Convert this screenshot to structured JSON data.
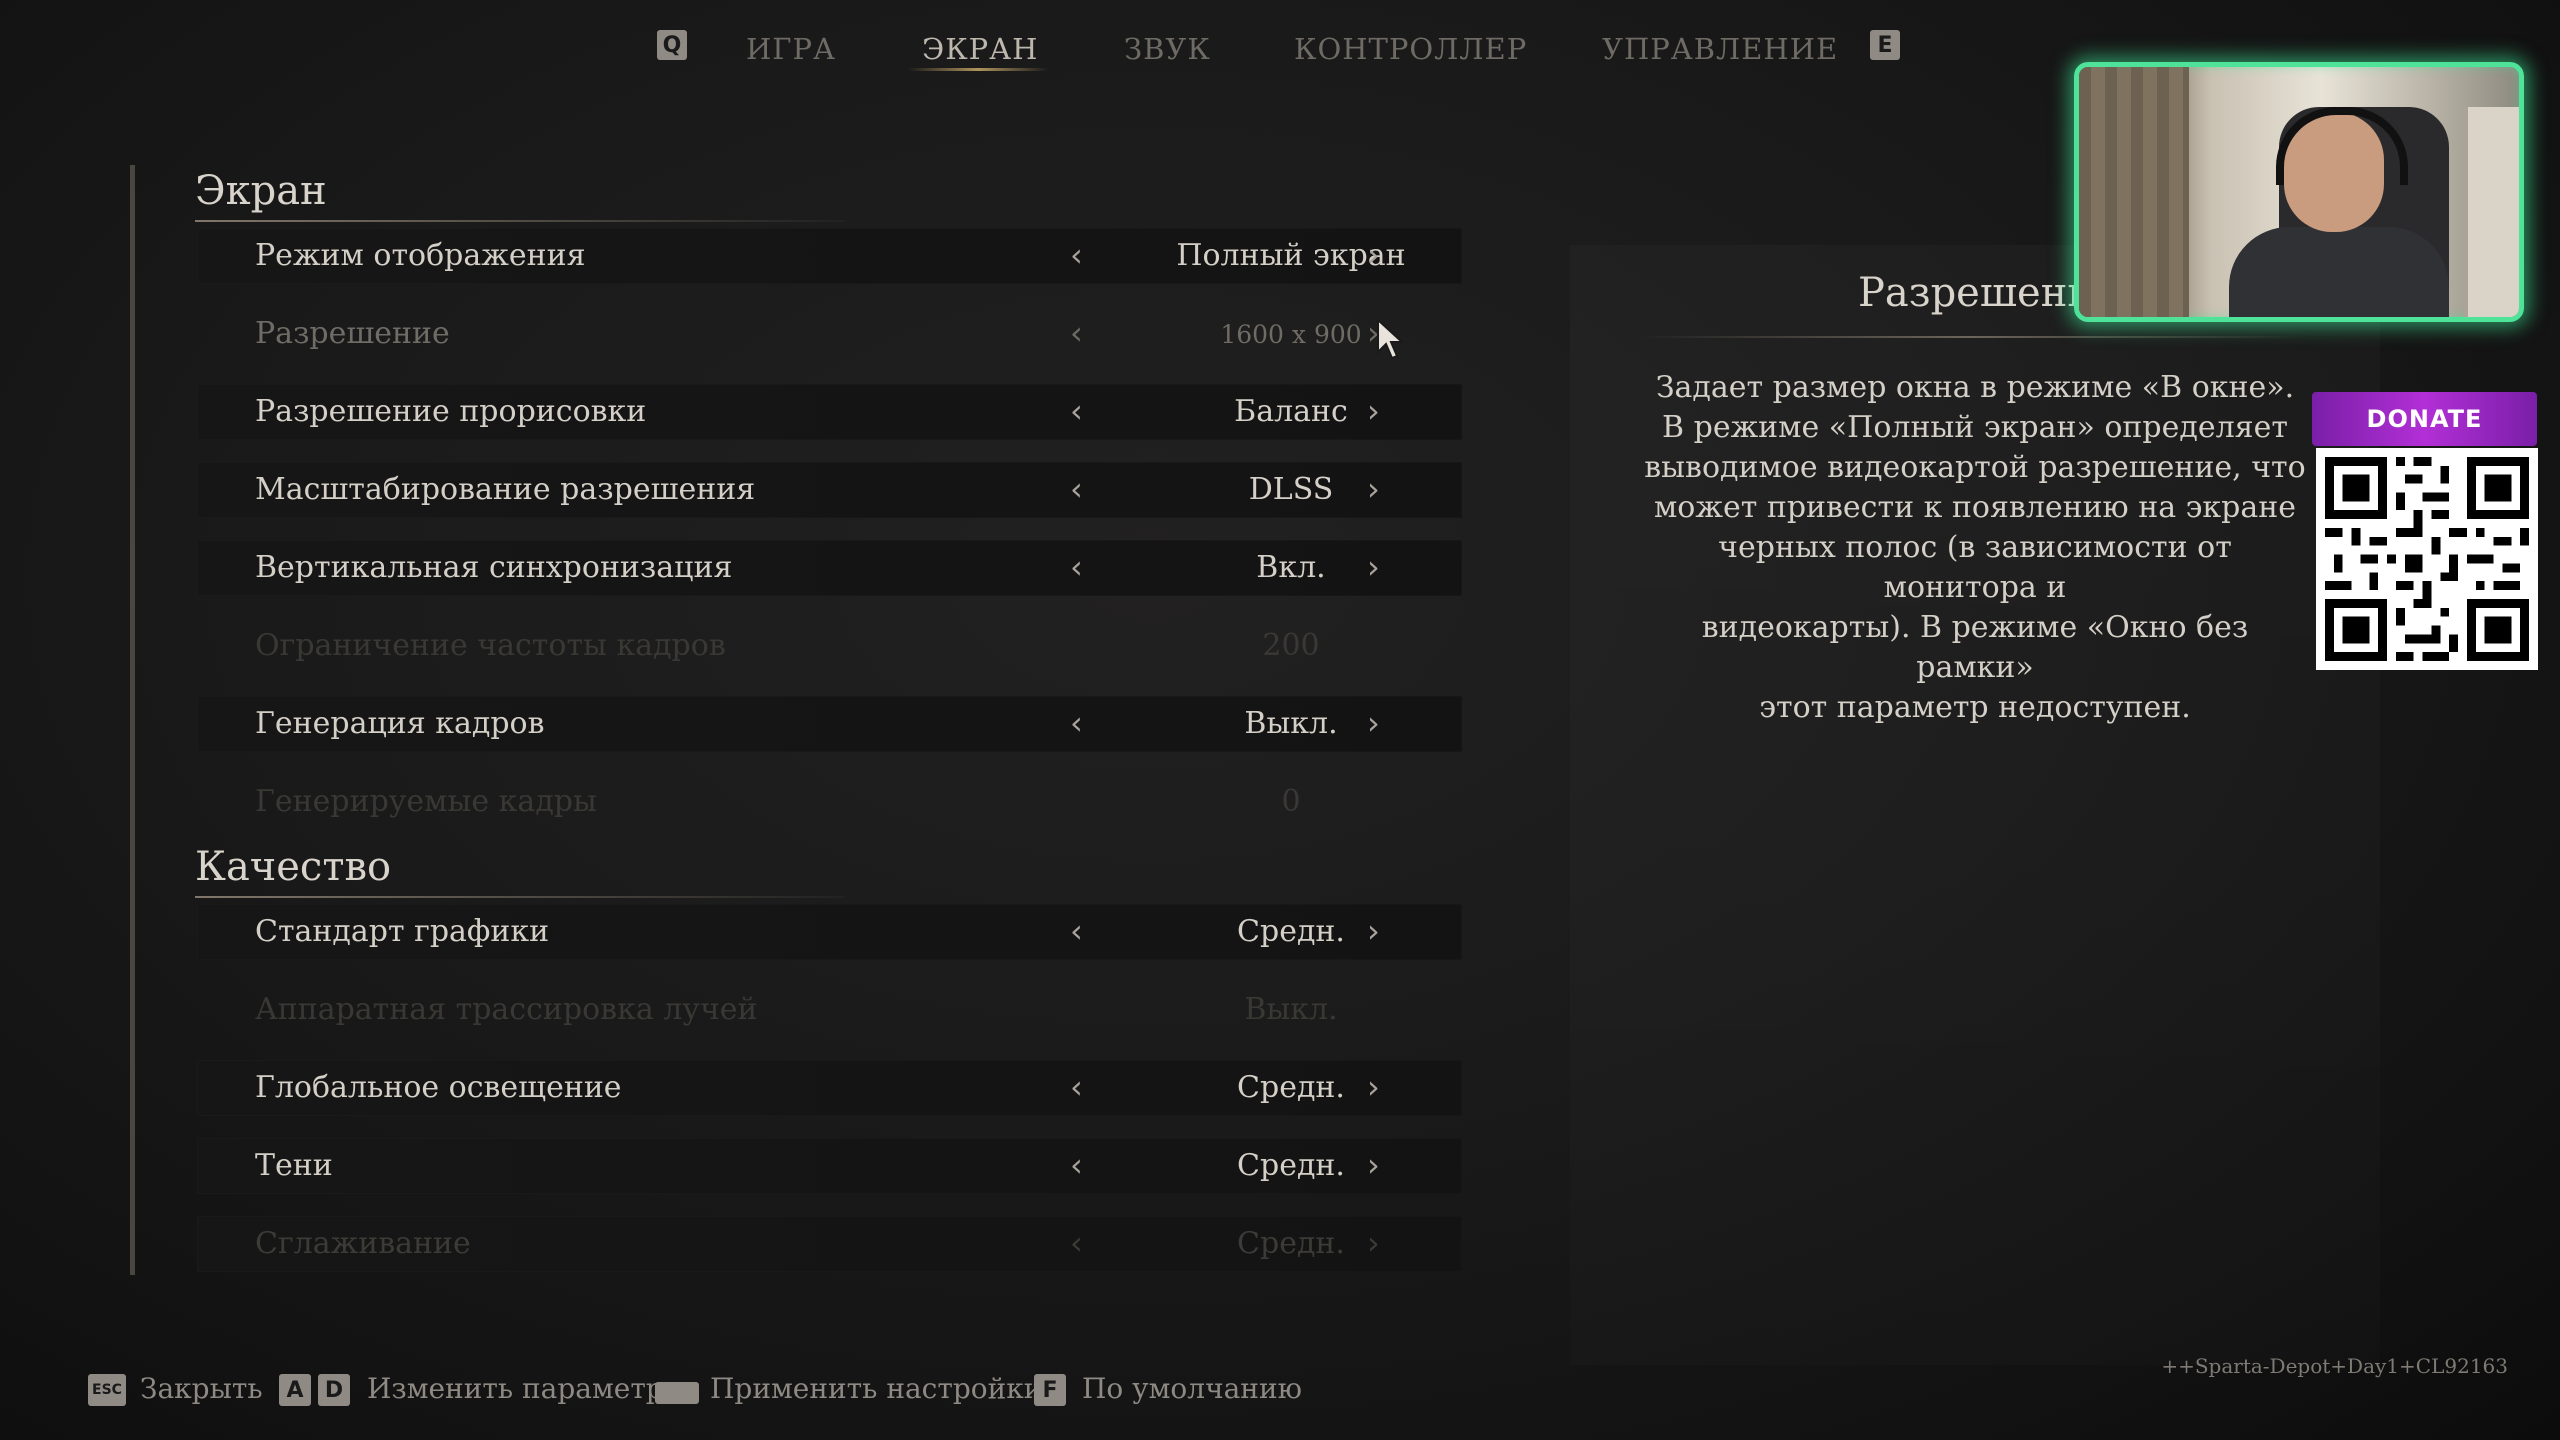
{
  "top_nav": {
    "key_left": "Q",
    "key_right": "E",
    "tabs": [
      {
        "label": "ИГРА"
      },
      {
        "label": "ЭКРАН"
      },
      {
        "label": "ЗВУК"
      },
      {
        "label": "КОНТРОЛЛЕР"
      },
      {
        "label": "УПРАВЛЕНИЕ"
      }
    ],
    "active_tab": "ЭКРАН"
  },
  "sections": {
    "screen": {
      "title": "Экран",
      "rows": [
        {
          "label": "Режим отображения",
          "value": "Полный экран"
        },
        {
          "label": "Разрешение",
          "value": "1600 x 900"
        },
        {
          "label": "Разрешение прорисовки",
          "value": "Баланс"
        },
        {
          "label": "Масштабирование разрешения",
          "value": "DLSS"
        },
        {
          "label": "Вертикальная синхронизация",
          "value": "Вкл."
        },
        {
          "label": "Ограничение частоты кадров",
          "value": "200"
        },
        {
          "label": "Генерация кадров",
          "value": "Выкл."
        },
        {
          "label": "Генерируемые кадры",
          "value": "0"
        }
      ]
    },
    "quality": {
      "title": "Качество",
      "rows": [
        {
          "label": "Стандарт графики",
          "value": "Средн."
        },
        {
          "label": "Аппаратная трассировка лучей",
          "value": "Выкл."
        },
        {
          "label": "Глобальное освещение",
          "value": "Средн."
        },
        {
          "label": "Тени",
          "value": "Средн."
        },
        {
          "label": "Сглаживание",
          "value": "Средн."
        }
      ]
    }
  },
  "description": {
    "title": "Разрешение",
    "lines": [
      "Задает размер окна в режиме «В окне».",
      "В режиме «Полный экран» определяет",
      "выводимое видеокартой разрешение, что",
      "может привести к появлению на экране",
      "черных полос (в зависимости от монитора и",
      "видеокарты). В режиме «Окно без рамки»",
      "этот параметр недоступен."
    ]
  },
  "overlay": {
    "donate_label": "DONATE"
  },
  "bottom_hints": {
    "close": {
      "key": "ESC",
      "label": "Закрыть"
    },
    "change": {
      "key_a": "A",
      "key_d": "D",
      "label": "Изменить параметр"
    },
    "apply": {
      "key": "",
      "label": "Применить настройки"
    },
    "default": {
      "key": "F",
      "label": "По умолчанию"
    }
  },
  "build_string": "++Sparta-Depot+Day1+CL92163",
  "colors": {
    "background": "#1a1a1a",
    "text": "#d4cfc7",
    "disabled_text": "#3a3835",
    "accent_gold": "#be9f64",
    "webcam_glow": "#4fe39a",
    "donate_purple": "#b22fd6"
  },
  "icons": {
    "left_arrow": "chevron-left-icon",
    "right_arrow": "chevron-right-icon",
    "cursor": "mouse-cursor-icon"
  }
}
